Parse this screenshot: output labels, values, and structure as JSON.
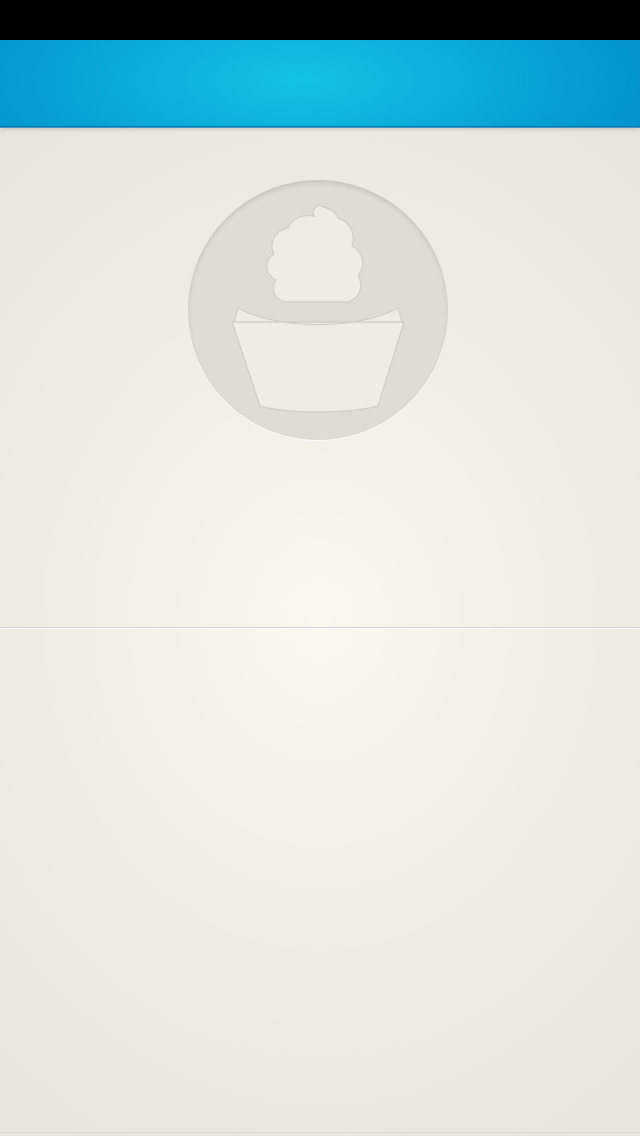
{
  "status_bar": {},
  "nav_bar": {
    "colors": {
      "center": "#12c3e2",
      "edge": "#0392cf"
    }
  },
  "profile": {
    "placeholder_icon": "cupcake-icon"
  },
  "colors": {
    "background": "#f0eee4",
    "placeholder_circle": "#dedcd4"
  }
}
